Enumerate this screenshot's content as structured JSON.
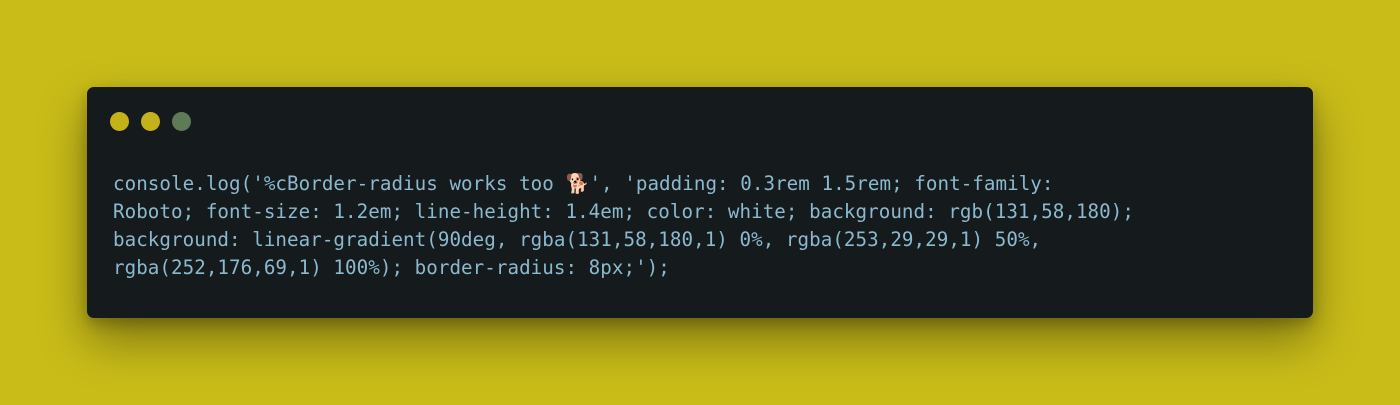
{
  "editor": {
    "window_controls": [
      {
        "name": "dot-1",
        "color": "#c4b21a"
      },
      {
        "name": "dot-2",
        "color": "#c4b21a"
      },
      {
        "name": "dot-3",
        "color": "#5e7a58"
      }
    ],
    "code_lines": [
      {
        "before": "console.log('%cBorder-radius works too ",
        "emoji": "🐕",
        "after": "', 'padding: 0.3rem 1.5rem; font-family:"
      },
      {
        "text": "Roboto; font-size: 1.2em; line-height: 1.4em; color: white; background: rgb(131,58,180);"
      },
      {
        "text": "background: linear-gradient(90deg, rgba(131,58,180,1) 0%, rgba(253,29,29,1) 50%,"
      },
      {
        "text": "rgba(252,176,69,1) 100%); border-radius: 8px;');"
      }
    ]
  },
  "colors": {
    "background": "#c9bc19",
    "window": "#151a1c",
    "code_text": "#8bb9cf"
  }
}
